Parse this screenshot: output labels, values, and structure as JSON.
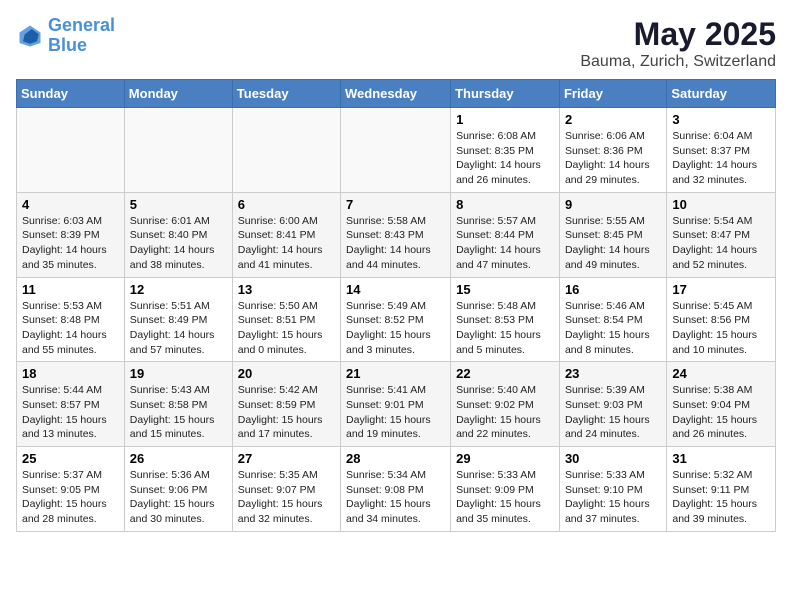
{
  "logo": {
    "line1": "General",
    "line2": "Blue"
  },
  "title": "May 2025",
  "subtitle": "Bauma, Zurich, Switzerland",
  "days_of_week": [
    "Sunday",
    "Monday",
    "Tuesday",
    "Wednesday",
    "Thursday",
    "Friday",
    "Saturday"
  ],
  "weeks": [
    [
      {
        "day": "",
        "info": ""
      },
      {
        "day": "",
        "info": ""
      },
      {
        "day": "",
        "info": ""
      },
      {
        "day": "",
        "info": ""
      },
      {
        "day": "1",
        "info": "Sunrise: 6:08 AM\nSunset: 8:35 PM\nDaylight: 14 hours\nand 26 minutes."
      },
      {
        "day": "2",
        "info": "Sunrise: 6:06 AM\nSunset: 8:36 PM\nDaylight: 14 hours\nand 29 minutes."
      },
      {
        "day": "3",
        "info": "Sunrise: 6:04 AM\nSunset: 8:37 PM\nDaylight: 14 hours\nand 32 minutes."
      }
    ],
    [
      {
        "day": "4",
        "info": "Sunrise: 6:03 AM\nSunset: 8:39 PM\nDaylight: 14 hours\nand 35 minutes."
      },
      {
        "day": "5",
        "info": "Sunrise: 6:01 AM\nSunset: 8:40 PM\nDaylight: 14 hours\nand 38 minutes."
      },
      {
        "day": "6",
        "info": "Sunrise: 6:00 AM\nSunset: 8:41 PM\nDaylight: 14 hours\nand 41 minutes."
      },
      {
        "day": "7",
        "info": "Sunrise: 5:58 AM\nSunset: 8:43 PM\nDaylight: 14 hours\nand 44 minutes."
      },
      {
        "day": "8",
        "info": "Sunrise: 5:57 AM\nSunset: 8:44 PM\nDaylight: 14 hours\nand 47 minutes."
      },
      {
        "day": "9",
        "info": "Sunrise: 5:55 AM\nSunset: 8:45 PM\nDaylight: 14 hours\nand 49 minutes."
      },
      {
        "day": "10",
        "info": "Sunrise: 5:54 AM\nSunset: 8:47 PM\nDaylight: 14 hours\nand 52 minutes."
      }
    ],
    [
      {
        "day": "11",
        "info": "Sunrise: 5:53 AM\nSunset: 8:48 PM\nDaylight: 14 hours\nand 55 minutes."
      },
      {
        "day": "12",
        "info": "Sunrise: 5:51 AM\nSunset: 8:49 PM\nDaylight: 14 hours\nand 57 minutes."
      },
      {
        "day": "13",
        "info": "Sunrise: 5:50 AM\nSunset: 8:51 PM\nDaylight: 15 hours\nand 0 minutes."
      },
      {
        "day": "14",
        "info": "Sunrise: 5:49 AM\nSunset: 8:52 PM\nDaylight: 15 hours\nand 3 minutes."
      },
      {
        "day": "15",
        "info": "Sunrise: 5:48 AM\nSunset: 8:53 PM\nDaylight: 15 hours\nand 5 minutes."
      },
      {
        "day": "16",
        "info": "Sunrise: 5:46 AM\nSunset: 8:54 PM\nDaylight: 15 hours\nand 8 minutes."
      },
      {
        "day": "17",
        "info": "Sunrise: 5:45 AM\nSunset: 8:56 PM\nDaylight: 15 hours\nand 10 minutes."
      }
    ],
    [
      {
        "day": "18",
        "info": "Sunrise: 5:44 AM\nSunset: 8:57 PM\nDaylight: 15 hours\nand 13 minutes."
      },
      {
        "day": "19",
        "info": "Sunrise: 5:43 AM\nSunset: 8:58 PM\nDaylight: 15 hours\nand 15 minutes."
      },
      {
        "day": "20",
        "info": "Sunrise: 5:42 AM\nSunset: 8:59 PM\nDaylight: 15 hours\nand 17 minutes."
      },
      {
        "day": "21",
        "info": "Sunrise: 5:41 AM\nSunset: 9:01 PM\nDaylight: 15 hours\nand 19 minutes."
      },
      {
        "day": "22",
        "info": "Sunrise: 5:40 AM\nSunset: 9:02 PM\nDaylight: 15 hours\nand 22 minutes."
      },
      {
        "day": "23",
        "info": "Sunrise: 5:39 AM\nSunset: 9:03 PM\nDaylight: 15 hours\nand 24 minutes."
      },
      {
        "day": "24",
        "info": "Sunrise: 5:38 AM\nSunset: 9:04 PM\nDaylight: 15 hours\nand 26 minutes."
      }
    ],
    [
      {
        "day": "25",
        "info": "Sunrise: 5:37 AM\nSunset: 9:05 PM\nDaylight: 15 hours\nand 28 minutes."
      },
      {
        "day": "26",
        "info": "Sunrise: 5:36 AM\nSunset: 9:06 PM\nDaylight: 15 hours\nand 30 minutes."
      },
      {
        "day": "27",
        "info": "Sunrise: 5:35 AM\nSunset: 9:07 PM\nDaylight: 15 hours\nand 32 minutes."
      },
      {
        "day": "28",
        "info": "Sunrise: 5:34 AM\nSunset: 9:08 PM\nDaylight: 15 hours\nand 34 minutes."
      },
      {
        "day": "29",
        "info": "Sunrise: 5:33 AM\nSunset: 9:09 PM\nDaylight: 15 hours\nand 35 minutes."
      },
      {
        "day": "30",
        "info": "Sunrise: 5:33 AM\nSunset: 9:10 PM\nDaylight: 15 hours\nand 37 minutes."
      },
      {
        "day": "31",
        "info": "Sunrise: 5:32 AM\nSunset: 9:11 PM\nDaylight: 15 hours\nand 39 minutes."
      }
    ]
  ]
}
